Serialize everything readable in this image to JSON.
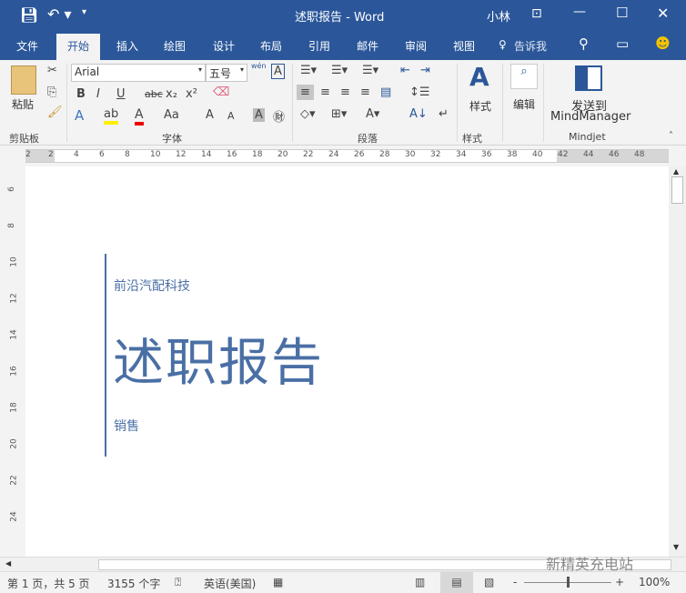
{
  "titlebar": {
    "title": "述职报告  -  Word",
    "user": "小林"
  },
  "tabs": [
    "文件",
    "开始",
    "插入",
    "绘图",
    "设计",
    "布局",
    "引用",
    "邮件",
    "审阅",
    "视图"
  ],
  "tell_me": "告诉我",
  "ribbon": {
    "paste": "粘贴",
    "clipboard": "剪贴板",
    "font_name": "Arial",
    "font_size": "五号",
    "font_group": "字体",
    "paragraph_group": "段落",
    "styles": "样式",
    "styles_group": "样式",
    "editing": "编辑",
    "send_to": "发送到",
    "mindmanager": "MindManager",
    "mindjet": "Mindjet",
    "bold": "B",
    "italic": "I",
    "underline": "U",
    "strike": "abc",
    "sub": "x₂",
    "sup": "x²",
    "aa": "Aa",
    "grow": "A",
    "shrink": "A",
    "phonetic": "wén"
  },
  "ruler": {
    "ticks": [
      "2",
      "2",
      "4",
      "6",
      "8",
      "10",
      "12",
      "14",
      "16",
      "18",
      "20",
      "22",
      "24",
      "26",
      "28",
      "30",
      "32",
      "34",
      "36",
      "38",
      "40",
      "42",
      "44",
      "46",
      "48"
    ],
    "vticks": [
      "6",
      "8",
      "10",
      "12",
      "14",
      "16",
      "18",
      "20",
      "22",
      "24"
    ]
  },
  "document": {
    "company": "前沿汽配科技",
    "title": "述职报告",
    "dept": "销售"
  },
  "status": {
    "page": "第 1 页，共 5 页",
    "words": "3155 个字",
    "language": "英语(美国)",
    "zoom": "100%",
    "zoom_level": 100
  },
  "watermark": "新精英充电站",
  "colors": {
    "brand": "#2b579a",
    "doc_text": "#4a6fa5"
  }
}
